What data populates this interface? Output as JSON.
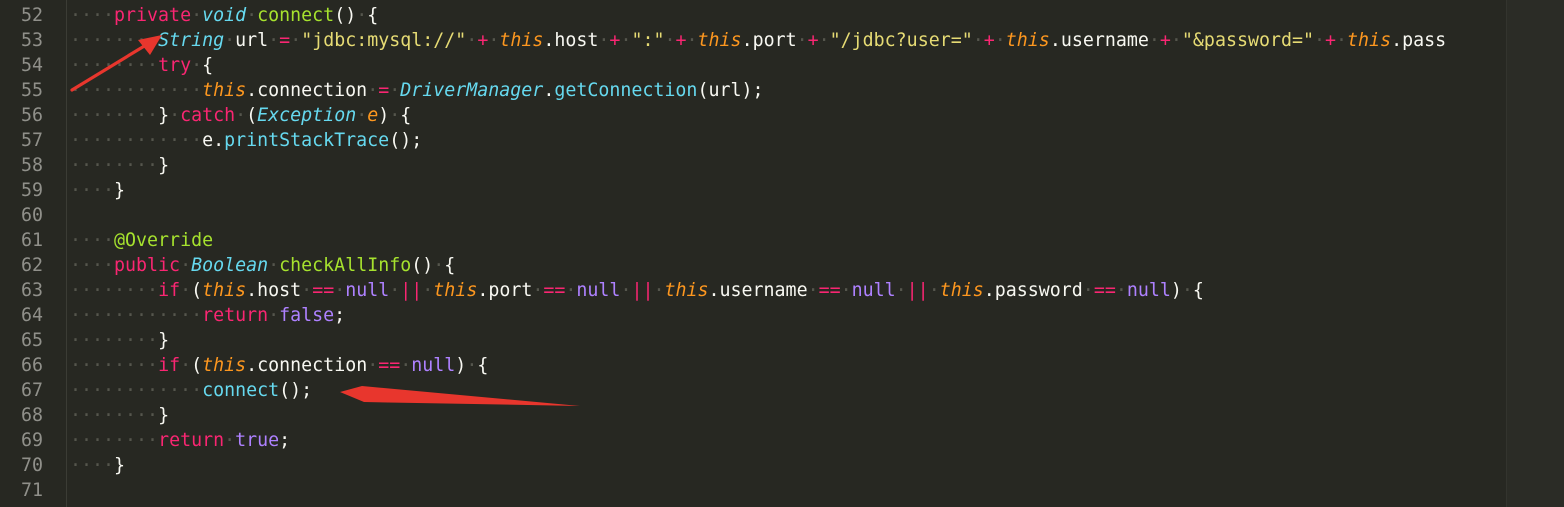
{
  "editor": {
    "theme_colors": {
      "background": "#272822",
      "keyword": "#f92672",
      "type": "#66d9ef",
      "function": "#a6e22e",
      "string": "#e6db74",
      "this": "#fd971f",
      "constant": "#ae81ff",
      "annotation_arrow": "#e8362d"
    },
    "lines": [
      {
        "num": "52",
        "tokens": [
          [
            "ws",
            "····"
          ],
          [
            "kw",
            "private"
          ],
          [
            "ws",
            "·"
          ],
          [
            "type",
            "void"
          ],
          [
            "ws",
            "·"
          ],
          [
            "fn",
            "connect"
          ],
          [
            "p",
            "()"
          ],
          [
            "ws",
            "·"
          ],
          [
            "p",
            "{"
          ]
        ]
      },
      {
        "num": "53",
        "tokens": [
          [
            "ws",
            "········"
          ],
          [
            "type",
            "String"
          ],
          [
            "ws",
            "·"
          ],
          [
            "p",
            "url"
          ],
          [
            "ws",
            "·"
          ],
          [
            "op",
            "="
          ],
          [
            "ws",
            "·"
          ],
          [
            "str",
            "\"jdbc:mysql://\""
          ],
          [
            "ws",
            "·"
          ],
          [
            "op",
            "+"
          ],
          [
            "ws",
            "·"
          ],
          [
            "ths",
            "this"
          ],
          [
            "p",
            ".host"
          ],
          [
            "ws",
            "·"
          ],
          [
            "op",
            "+"
          ],
          [
            "ws",
            "·"
          ],
          [
            "str",
            "\":\""
          ],
          [
            "ws",
            "·"
          ],
          [
            "op",
            "+"
          ],
          [
            "ws",
            "·"
          ],
          [
            "ths",
            "this"
          ],
          [
            "p",
            ".port"
          ],
          [
            "ws",
            "·"
          ],
          [
            "op",
            "+"
          ],
          [
            "ws",
            "·"
          ],
          [
            "str",
            "\"/jdbc?user=\""
          ],
          [
            "ws",
            "·"
          ],
          [
            "op",
            "+"
          ],
          [
            "ws",
            "·"
          ],
          [
            "ths",
            "this"
          ],
          [
            "p",
            ".username"
          ],
          [
            "ws",
            "·"
          ],
          [
            "op",
            "+"
          ],
          [
            "ws",
            "·"
          ],
          [
            "str",
            "\"&password=\""
          ],
          [
            "ws",
            "·"
          ],
          [
            "op",
            "+"
          ],
          [
            "ws",
            "·"
          ],
          [
            "ths",
            "this"
          ],
          [
            "p",
            ".pass"
          ]
        ]
      },
      {
        "num": "54",
        "tokens": [
          [
            "ws",
            "········"
          ],
          [
            "kw",
            "try"
          ],
          [
            "ws",
            "·"
          ],
          [
            "p",
            "{"
          ]
        ]
      },
      {
        "num": "55",
        "tokens": [
          [
            "ws",
            "············"
          ],
          [
            "ths",
            "this"
          ],
          [
            "p",
            ".connection"
          ],
          [
            "ws",
            "·"
          ],
          [
            "op",
            "="
          ],
          [
            "ws",
            "·"
          ],
          [
            "type",
            "DriverManager"
          ],
          [
            "p",
            "."
          ],
          [
            "call",
            "getConnection"
          ],
          [
            "p",
            "(url);"
          ]
        ]
      },
      {
        "num": "56",
        "tokens": [
          [
            "ws",
            "········"
          ],
          [
            "p",
            "}"
          ],
          [
            "ws",
            "·"
          ],
          [
            "kw",
            "catch"
          ],
          [
            "ws",
            "·"
          ],
          [
            "p",
            "("
          ],
          [
            "type",
            "Exception"
          ],
          [
            "ws",
            "·"
          ],
          [
            "prm",
            "e"
          ],
          [
            "p",
            ")"
          ],
          [
            "ws",
            "·"
          ],
          [
            "p",
            "{"
          ]
        ]
      },
      {
        "num": "57",
        "tokens": [
          [
            "ws",
            "············"
          ],
          [
            "p",
            "e."
          ],
          [
            "call",
            "printStackTrace"
          ],
          [
            "p",
            "();"
          ]
        ]
      },
      {
        "num": "58",
        "tokens": [
          [
            "ws",
            "········"
          ],
          [
            "p",
            "}"
          ]
        ]
      },
      {
        "num": "59",
        "tokens": [
          [
            "ws",
            "····"
          ],
          [
            "p",
            "}"
          ]
        ]
      },
      {
        "num": "60",
        "tokens": []
      },
      {
        "num": "61",
        "tokens": [
          [
            "ws",
            "····"
          ],
          [
            "fn",
            "@Override"
          ]
        ]
      },
      {
        "num": "62",
        "tokens": [
          [
            "ws",
            "····"
          ],
          [
            "kw",
            "public"
          ],
          [
            "ws",
            "·"
          ],
          [
            "type",
            "Boolean"
          ],
          [
            "ws",
            "·"
          ],
          [
            "fn",
            "checkAllInfo"
          ],
          [
            "p",
            "()"
          ],
          [
            "ws",
            "·"
          ],
          [
            "p",
            "{"
          ]
        ]
      },
      {
        "num": "63",
        "tokens": [
          [
            "ws",
            "········"
          ],
          [
            "kw",
            "if"
          ],
          [
            "ws",
            "·"
          ],
          [
            "p",
            "("
          ],
          [
            "ths",
            "this"
          ],
          [
            "p",
            ".host"
          ],
          [
            "ws",
            "·"
          ],
          [
            "op",
            "=="
          ],
          [
            "ws",
            "·"
          ],
          [
            "cst",
            "null"
          ],
          [
            "ws",
            "·"
          ],
          [
            "op",
            "||"
          ],
          [
            "ws",
            "·"
          ],
          [
            "ths",
            "this"
          ],
          [
            "p",
            ".port"
          ],
          [
            "ws",
            "·"
          ],
          [
            "op",
            "=="
          ],
          [
            "ws",
            "·"
          ],
          [
            "cst",
            "null"
          ],
          [
            "ws",
            "·"
          ],
          [
            "op",
            "||"
          ],
          [
            "ws",
            "·"
          ],
          [
            "ths",
            "this"
          ],
          [
            "p",
            ".username"
          ],
          [
            "ws",
            "·"
          ],
          [
            "op",
            "=="
          ],
          [
            "ws",
            "·"
          ],
          [
            "cst",
            "null"
          ],
          [
            "ws",
            "·"
          ],
          [
            "op",
            "||"
          ],
          [
            "ws",
            "·"
          ],
          [
            "ths",
            "this"
          ],
          [
            "p",
            ".password"
          ],
          [
            "ws",
            "·"
          ],
          [
            "op",
            "=="
          ],
          [
            "ws",
            "·"
          ],
          [
            "cst",
            "null"
          ],
          [
            "p",
            ")"
          ],
          [
            "ws",
            "·"
          ],
          [
            "p",
            "{"
          ]
        ]
      },
      {
        "num": "64",
        "tokens": [
          [
            "ws",
            "············"
          ],
          [
            "kw",
            "return"
          ],
          [
            "ws",
            "·"
          ],
          [
            "cst",
            "false"
          ],
          [
            "p",
            ";"
          ]
        ]
      },
      {
        "num": "65",
        "tokens": [
          [
            "ws",
            "········"
          ],
          [
            "p",
            "}"
          ]
        ]
      },
      {
        "num": "66",
        "tokens": [
          [
            "ws",
            "········"
          ],
          [
            "kw",
            "if"
          ],
          [
            "ws",
            "·"
          ],
          [
            "p",
            "("
          ],
          [
            "ths",
            "this"
          ],
          [
            "p",
            ".connection"
          ],
          [
            "ws",
            "·"
          ],
          [
            "op",
            "=="
          ],
          [
            "ws",
            "·"
          ],
          [
            "cst",
            "null"
          ],
          [
            "p",
            ")"
          ],
          [
            "ws",
            "·"
          ],
          [
            "p",
            "{"
          ]
        ]
      },
      {
        "num": "67",
        "tokens": [
          [
            "ws",
            "············"
          ],
          [
            "call",
            "connect"
          ],
          [
            "p",
            "();"
          ]
        ]
      },
      {
        "num": "68",
        "tokens": [
          [
            "ws",
            "········"
          ],
          [
            "p",
            "}"
          ]
        ]
      },
      {
        "num": "69",
        "tokens": [
          [
            "ws",
            "········"
          ],
          [
            "kw",
            "return"
          ],
          [
            "ws",
            "·"
          ],
          [
            "cst",
            "true"
          ],
          [
            "p",
            ";"
          ]
        ]
      },
      {
        "num": "70",
        "tokens": [
          [
            "ws",
            "····"
          ],
          [
            "p",
            "}"
          ]
        ]
      },
      {
        "num": "71",
        "tokens": []
      }
    ]
  }
}
